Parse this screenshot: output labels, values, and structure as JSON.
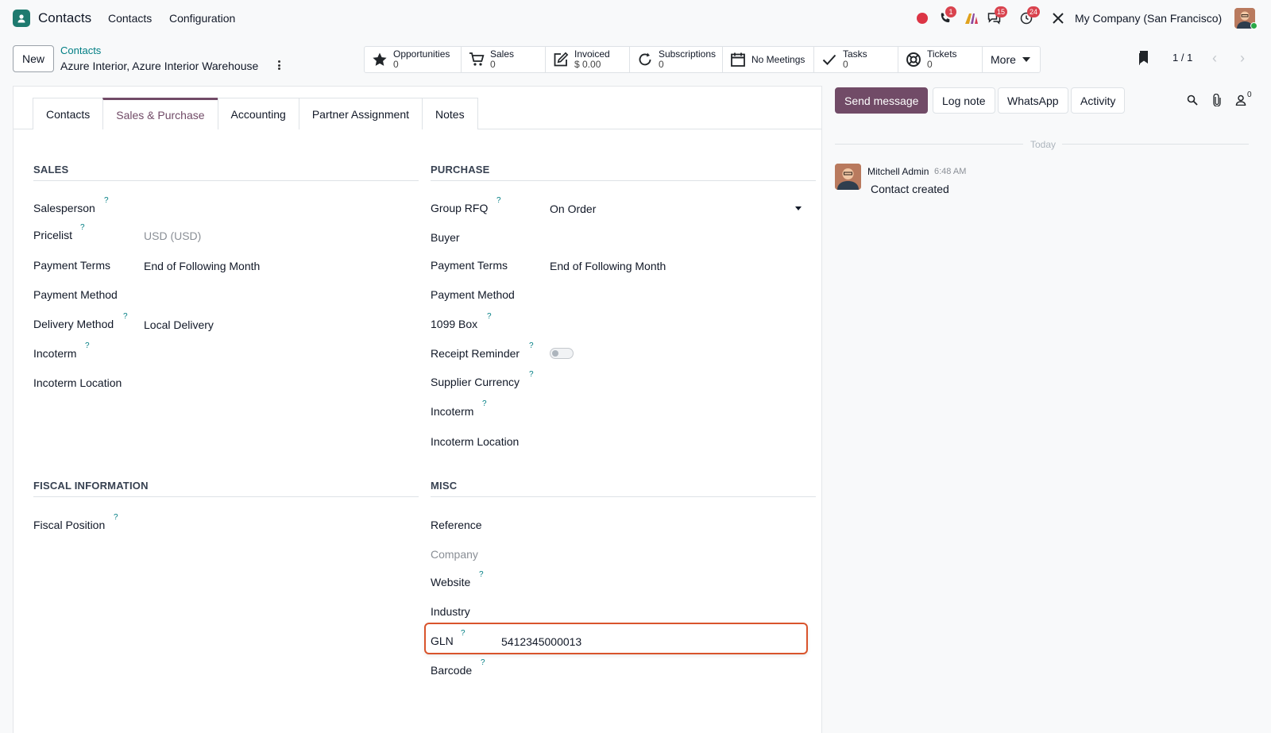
{
  "navbar": {
    "app_name": "Contacts",
    "menus": [
      "Contacts",
      "Configuration"
    ],
    "badges": {
      "phone": "1",
      "discuss": "15",
      "activity": "24"
    },
    "company": "My Company (San Francisco)"
  },
  "control": {
    "new_label": "New",
    "breadcrumb": "Contacts",
    "record_name": "Azure Interior, Azure Interior Warehouse",
    "pager": "1 / 1"
  },
  "smart_buttons": {
    "opportunities": {
      "label": "Opportunities",
      "value": "0"
    },
    "sales": {
      "label": "Sales",
      "value": "0"
    },
    "invoiced": {
      "label": "Invoiced",
      "value": "$ 0.00"
    },
    "subscriptions": {
      "label": "Subscriptions",
      "value": "0"
    },
    "meetings": {
      "label": "No Meetings"
    },
    "tasks": {
      "label": "Tasks",
      "value": "0"
    },
    "tickets": {
      "label": "Tickets",
      "value": "0"
    },
    "more": {
      "label": "More"
    }
  },
  "tabs": [
    "Contacts",
    "Sales & Purchase",
    "Accounting",
    "Partner Assignment",
    "Notes"
  ],
  "sales": {
    "title": "SALES",
    "salesperson": "Salesperson",
    "pricelist": "Pricelist",
    "pricelist_value": "USD (USD)",
    "payment_terms": "Payment Terms",
    "payment_terms_value": "End of Following Month",
    "payment_method": "Payment Method",
    "delivery_method": "Delivery Method",
    "delivery_method_value": "Local Delivery",
    "incoterm": "Incoterm",
    "incoterm_location": "Incoterm Location"
  },
  "purchase": {
    "title": "PURCHASE",
    "group_rfq": "Group RFQ",
    "group_rfq_value": "On Order",
    "buyer": "Buyer",
    "payment_terms": "Payment Terms",
    "payment_terms_value": "End of Following Month",
    "payment_method": "Payment Method",
    "box_1099": "1099 Box",
    "receipt_reminder": "Receipt Reminder",
    "supplier_currency": "Supplier Currency",
    "incoterm": "Incoterm",
    "incoterm_location": "Incoterm Location"
  },
  "fiscal": {
    "title": "FISCAL INFORMATION",
    "fiscal_position": "Fiscal Position"
  },
  "misc": {
    "title": "MISC",
    "reference": "Reference",
    "company": "Company",
    "website": "Website",
    "industry": "Industry",
    "gln": "GLN",
    "gln_value": "5412345000013",
    "barcode": "Barcode"
  },
  "help_mark": "?",
  "chatter": {
    "send_message": "Send message",
    "log_note": "Log note",
    "whatsapp": "WhatsApp",
    "activity": "Activity",
    "followers_count": "0",
    "today": "Today",
    "message": {
      "author": "Mitchell Admin",
      "time": "6:48 AM",
      "body": "Contact created"
    }
  },
  "colors": {
    "primary": "#714b67",
    "link": "#017e84",
    "badge": "#d9434e",
    "highlight": "#d9542c"
  }
}
